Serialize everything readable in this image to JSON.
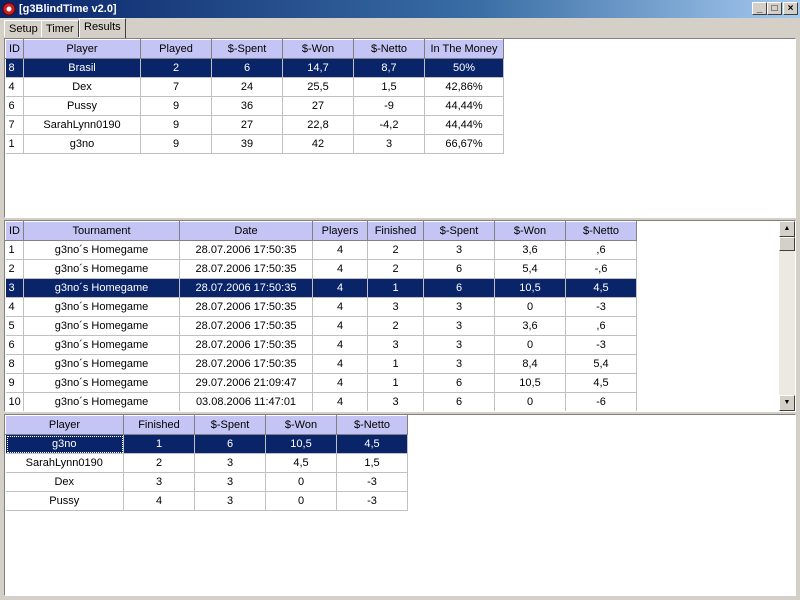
{
  "window": {
    "title": "[g3BlindTime v2.0]"
  },
  "tabs": [
    {
      "label": "Setup"
    },
    {
      "label": "Timer"
    },
    {
      "label": "Results"
    }
  ],
  "players_table": {
    "columns": [
      "ID",
      "Player",
      "Played",
      "$-Spent",
      "$-Won",
      "$-Netto",
      "In The Money"
    ],
    "rows": [
      [
        "8",
        "Brasil",
        "2",
        "6",
        "14,7",
        "8,7",
        "50%"
      ],
      [
        "4",
        "Dex",
        "7",
        "24",
        "25,5",
        "1,5",
        "42,86%"
      ],
      [
        "6",
        "Pussy",
        "9",
        "36",
        "27",
        "-9",
        "44,44%"
      ],
      [
        "7",
        "SarahLynn0190",
        "9",
        "27",
        "22,8",
        "-4,2",
        "44,44%"
      ],
      [
        "1",
        "g3no",
        "9",
        "39",
        "42",
        "3",
        "66,67%"
      ]
    ]
  },
  "tournaments_table": {
    "columns": [
      "ID",
      "Tournament",
      "Date",
      "Players",
      "Finished",
      "$-Spent",
      "$-Won",
      "$-Netto"
    ],
    "rows": [
      [
        "1",
        "g3no´s Homegame",
        "28.07.2006 17:50:35",
        "4",
        "2",
        "3",
        "3,6",
        ",6"
      ],
      [
        "2",
        "g3no´s Homegame",
        "28.07.2006 17:50:35",
        "4",
        "2",
        "6",
        "5,4",
        "-,6"
      ],
      [
        "3",
        "g3no´s Homegame",
        "28.07.2006 17:50:35",
        "4",
        "1",
        "6",
        "10,5",
        "4,5"
      ],
      [
        "4",
        "g3no´s Homegame",
        "28.07.2006 17:50:35",
        "4",
        "3",
        "3",
        "0",
        "-3"
      ],
      [
        "5",
        "g3no´s Homegame",
        "28.07.2006 17:50:35",
        "4",
        "2",
        "3",
        "3,6",
        ",6"
      ],
      [
        "6",
        "g3no´s Homegame",
        "28.07.2006 17:50:35",
        "4",
        "3",
        "3",
        "0",
        "-3"
      ],
      [
        "8",
        "g3no´s Homegame",
        "28.07.2006 17:50:35",
        "4",
        "1",
        "3",
        "8,4",
        "5,4"
      ],
      [
        "9",
        "g3no´s Homegame",
        "29.07.2006 21:09:47",
        "4",
        "1",
        "6",
        "10,5",
        "4,5"
      ],
      [
        "10",
        "g3no´s Homegame",
        "03.08.2006 11:47:01",
        "4",
        "3",
        "6",
        "0",
        "-6"
      ]
    ]
  },
  "details_table": {
    "columns": [
      "Player",
      "Finished",
      "$-Spent",
      "$-Won",
      "$-Netto"
    ],
    "rows": [
      [
        "g3no",
        "1",
        "6",
        "10,5",
        "4,5"
      ],
      [
        "SarahLynn0190",
        "2",
        "3",
        "4,5",
        "1,5"
      ],
      [
        "Dex",
        "3",
        "3",
        "0",
        "-3"
      ],
      [
        "Pussy",
        "4",
        "3",
        "0",
        "-3"
      ]
    ]
  },
  "icons": {
    "app": "poker-chip-icon",
    "minimize": "minimize-icon",
    "maximize": "maximize-icon",
    "close": "close-icon",
    "scroll_up": "arrow-up-icon",
    "scroll_down": "arrow-down-icon"
  },
  "colors": {
    "header_bg": "#c5c5f5",
    "selection": "#0a246a",
    "titlebar": "#0a246a"
  }
}
